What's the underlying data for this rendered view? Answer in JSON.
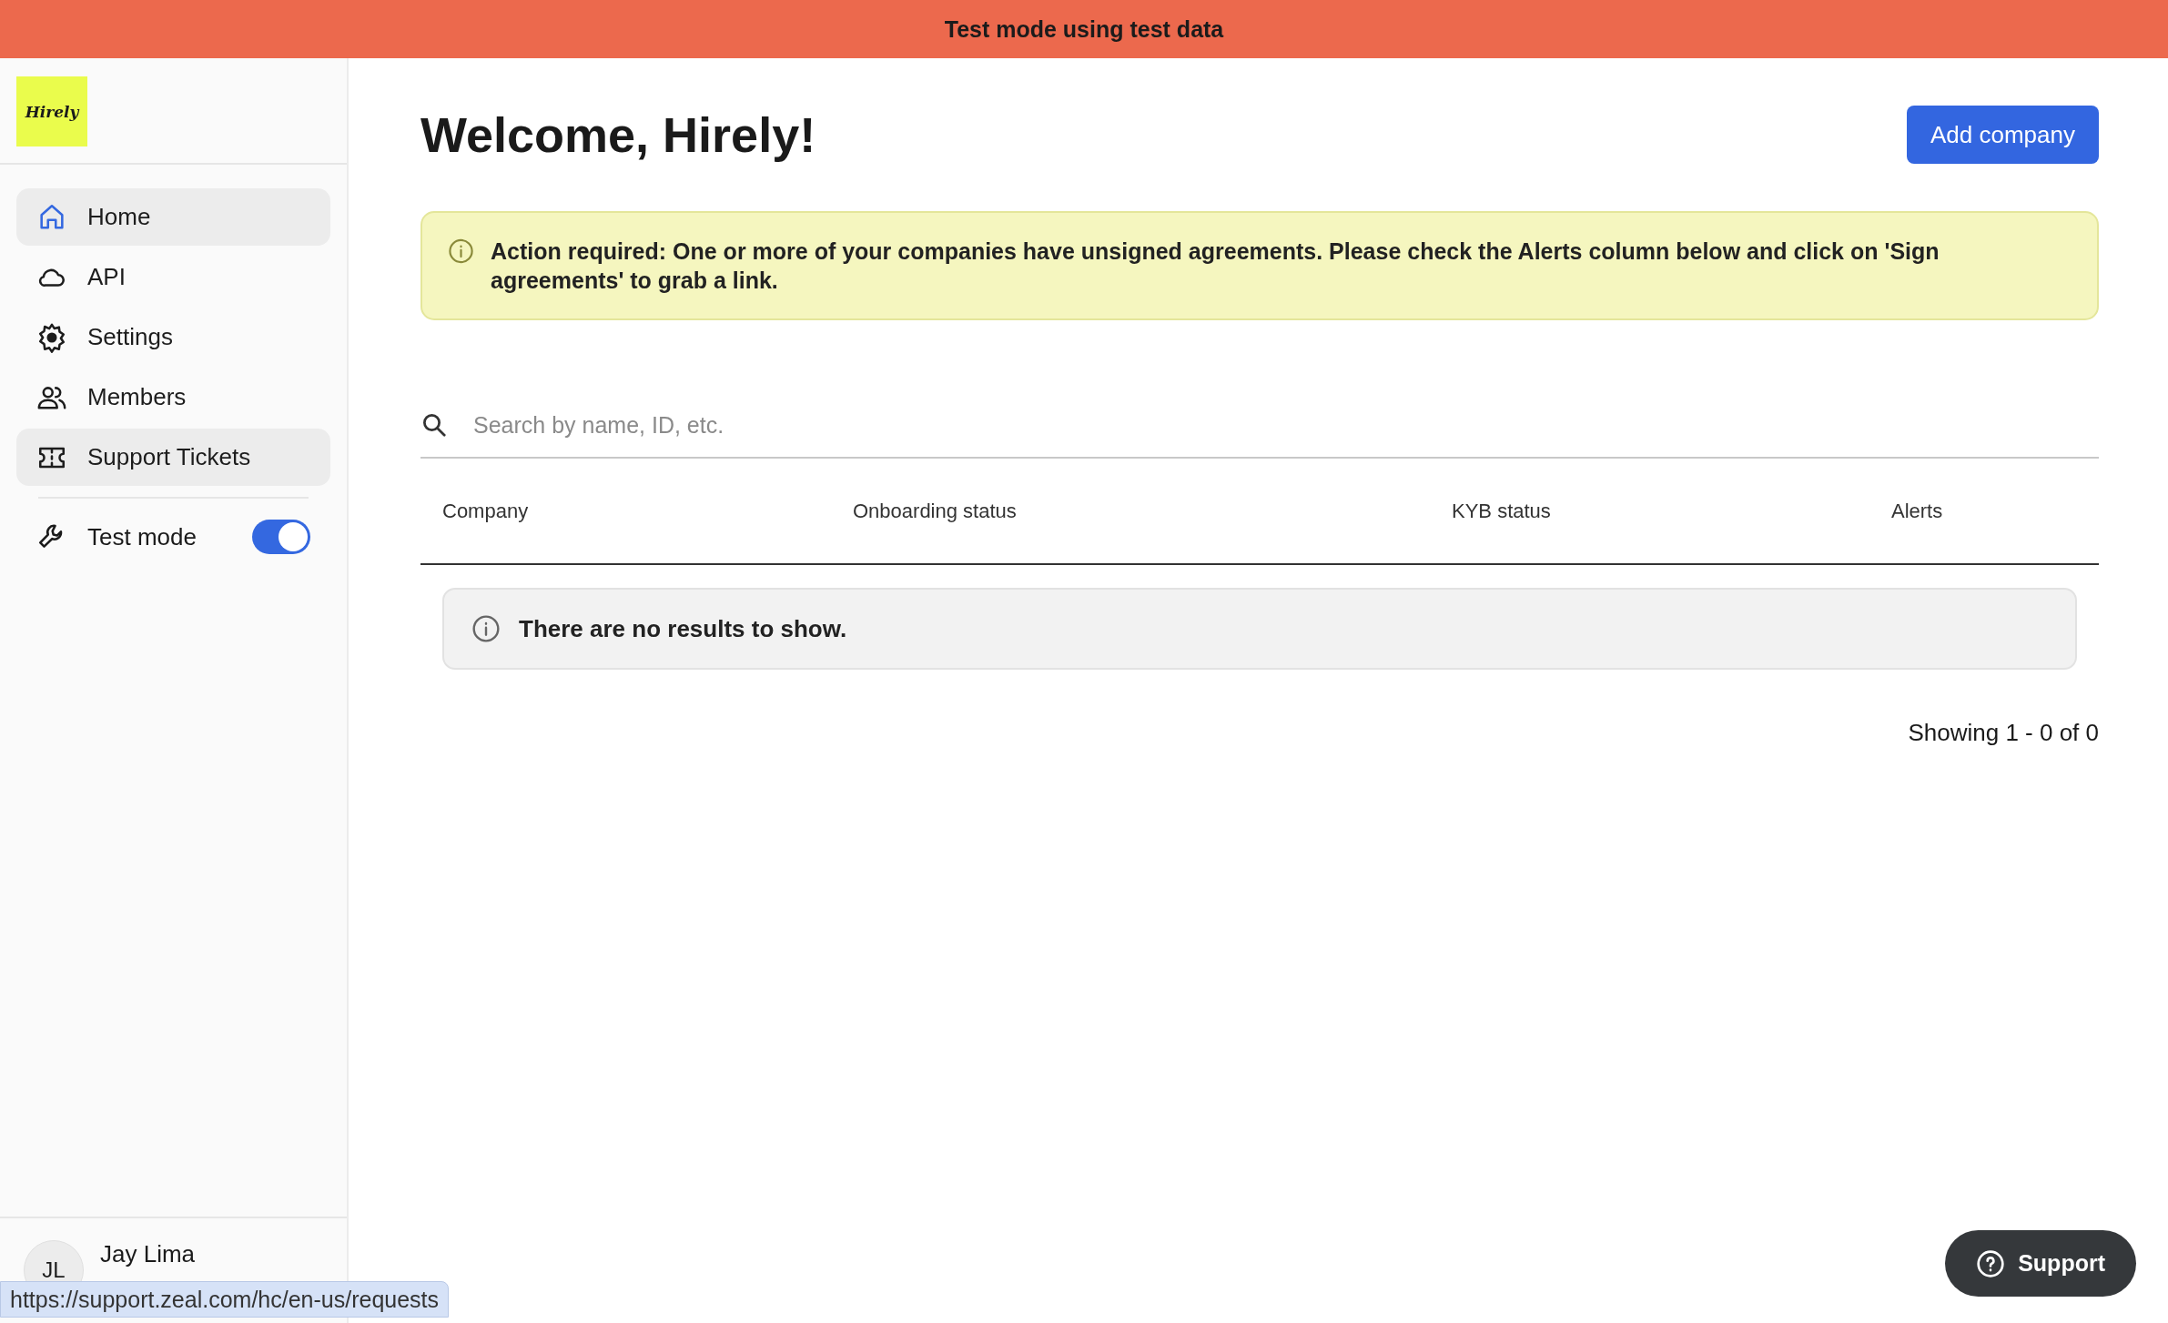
{
  "banner": {
    "text": "Test mode using test data"
  },
  "sidebar": {
    "logo": "Hirely",
    "items": [
      {
        "label": "Home",
        "selected": true,
        "highlighted": true
      },
      {
        "label": "API",
        "selected": false,
        "highlighted": false
      },
      {
        "label": "Settings",
        "selected": false,
        "highlighted": false
      },
      {
        "label": "Members",
        "selected": false,
        "highlighted": false
      },
      {
        "label": "Support Tickets",
        "selected": false,
        "highlighted": true
      }
    ],
    "test_mode": {
      "label": "Test mode",
      "on": true
    },
    "user": {
      "initials": "JL",
      "name": "Jay Lima"
    }
  },
  "main": {
    "title": "Welcome, Hirely!",
    "add_button": "Add company",
    "alert": "Action required: One or more of your companies have unsigned agreements. Please check the Alerts column below and click on 'Sign agreements' to grab a link.",
    "search": {
      "placeholder": "Search by name, ID, etc."
    },
    "table": {
      "columns": [
        "Company",
        "Onboarding status",
        "KYB status",
        "Alerts"
      ],
      "empty": "There are no results to show."
    },
    "pagination": "Showing 1 - 0 of 0"
  },
  "support_button": "Support",
  "status_url": "https://support.zeal.com/hc/en-us/requests"
}
